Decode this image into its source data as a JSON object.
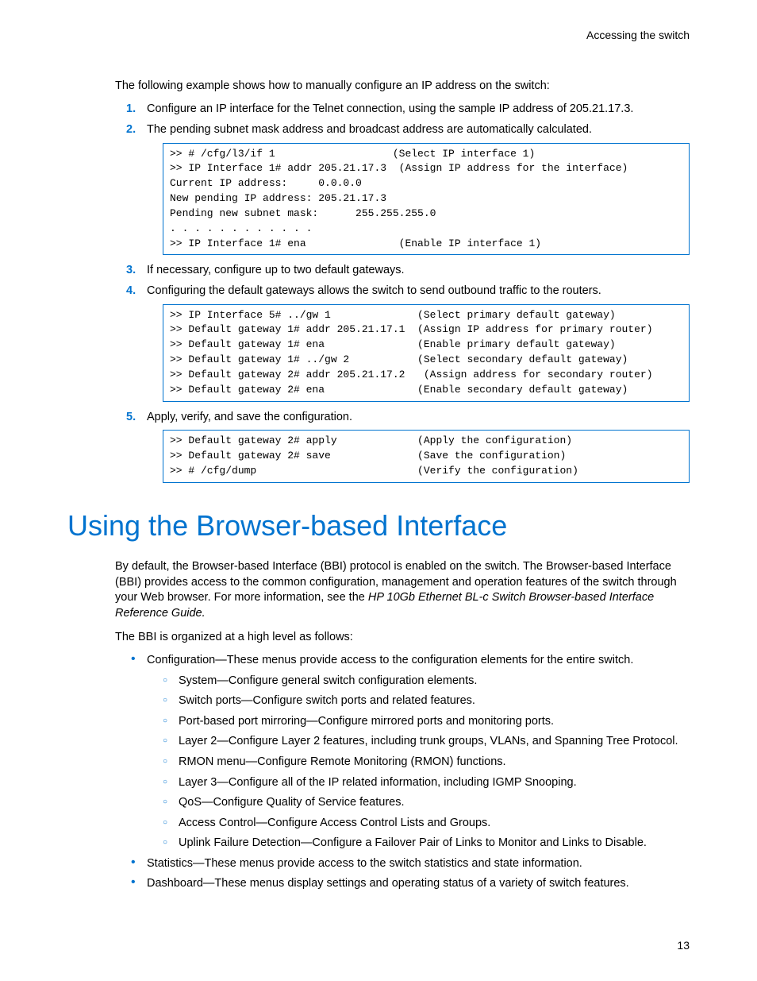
{
  "header": {
    "running": "Accessing the switch"
  },
  "intro": "The following example shows how to manually configure an IP address on the switch:",
  "steps": {
    "s1": "Configure an IP interface for the Telnet connection, using the sample IP address of 205.21.17.3.",
    "s2": "The pending subnet mask address and broadcast address are automatically calculated.",
    "s3": "If necessary, configure up to two default gateways.",
    "s4": "Configuring the default gateways allows the switch to send outbound traffic to the routers.",
    "s5": "Apply, verify, and save the configuration."
  },
  "code": {
    "block1": ">> # /cfg/l3/if 1                   (Select IP interface 1)\n>> IP Interface 1# addr 205.21.17.3  (Assign IP address for the interface)\nCurrent IP address:     0.0.0.0\nNew pending IP address: 205.21.17.3\nPending new subnet mask:      255.255.255.0\n. . . . . . . . . . . .\n>> IP Interface 1# ena               (Enable IP interface 1)",
    "block2": ">> IP Interface 5# ../gw 1              (Select primary default gateway)\n>> Default gateway 1# addr 205.21.17.1  (Assign IP address for primary router)\n>> Default gateway 1# ena               (Enable primary default gateway)\n>> Default gateway 1# ../gw 2           (Select secondary default gateway)\n>> Default gateway 2# addr 205.21.17.2   (Assign address for secondary router)\n>> Default gateway 2# ena               (Enable secondary default gateway)",
    "block3": ">> Default gateway 2# apply             (Apply the configuration)\n>> Default gateway 2# save              (Save the configuration)\n>> # /cfg/dump                          (Verify the configuration)"
  },
  "section_title": "Using the Browser-based Interface",
  "bbi": {
    "p1a": "By default, the Browser-based Interface (BBI) protocol is enabled on the switch. The Browser-based Interface (BBI) provides access to the common configuration, management and operation features of the switch through your Web browser. For more information, see the ",
    "p1b": "HP 10Gb Ethernet BL-c Switch Browser-based Interface Reference Guide.",
    "p2": "The BBI is organized at a high level as follows:",
    "bullets": {
      "config": "Configuration—These menus provide access to the configuration elements for the entire switch.",
      "config_items": {
        "system": "System—Configure general switch configuration elements.",
        "ports": "Switch ports—Configure switch ports and related features.",
        "mirror": "Port-based port mirroring—Configure mirrored ports and monitoring ports.",
        "l2": "Layer 2—Configure Layer 2 features, including trunk groups, VLANs, and Spanning Tree Protocol.",
        "rmon": "RMON menu—Configure Remote Monitoring (RMON) functions.",
        "l3": "Layer 3—Configure all of the IP related information, including IGMP Snooping.",
        "qos": "QoS—Configure Quality of Service features.",
        "acl": "Access Control—Configure Access Control Lists and Groups.",
        "ufd": "Uplink Failure Detection—Configure a Failover Pair of Links to Monitor and Links to Disable."
      },
      "stats": "Statistics—These menus provide access to the switch statistics and state information.",
      "dash": "Dashboard—These menus display settings and operating status of a variety of switch features."
    }
  },
  "page_number": "13"
}
